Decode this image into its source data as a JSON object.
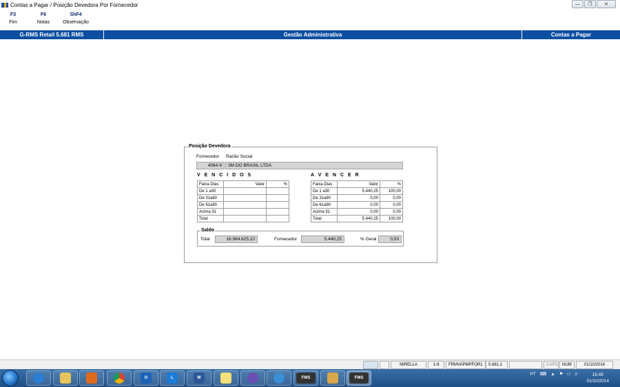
{
  "window": {
    "title": "Contas a Pagar / Posição Devedora Por Fornecedor"
  },
  "fkeys": [
    {
      "key": "F3",
      "label": "Fim"
    },
    {
      "key": "F6",
      "label": "Notas"
    },
    {
      "key": "ShF4",
      "label": "Observação"
    }
  ],
  "header": {
    "system": "G-RMS Retail 5.681 RMS",
    "area": "Gestão Administrativa",
    "module": "Contas a Pagar"
  },
  "panel": {
    "title": "Posição Devedora",
    "fornecedor_label": "Fornecedor",
    "razao_label": "Razão Social",
    "fornecedor_code": "4064-9",
    "razao_social": "3M DO BRASIL LTDA"
  },
  "vencidos": {
    "title": "V E N C I D O S",
    "headers": [
      "Faixa Dias",
      "Valor",
      "%"
    ],
    "rows": [
      {
        "faixa": "De 1 a30",
        "valor": "",
        "pct": ""
      },
      {
        "faixa": "De 31a60",
        "valor": "",
        "pct": ""
      },
      {
        "faixa": "De 61a90",
        "valor": "",
        "pct": ""
      },
      {
        "faixa": "Acima 91",
        "valor": "",
        "pct": ""
      },
      {
        "faixa": "Total",
        "valor": "",
        "pct": ""
      }
    ]
  },
  "avencer": {
    "title": "A V E N C E R",
    "headers": [
      "Faixa Dias",
      "Valor",
      "%"
    ],
    "rows": [
      {
        "faixa": "De 1 a30",
        "valor": "5.440,25",
        "pct": "100,00"
      },
      {
        "faixa": "De 31a60",
        "valor": "0,00",
        "pct": "0,00"
      },
      {
        "faixa": "De 61a90",
        "valor": "0,00",
        "pct": "0,00"
      },
      {
        "faixa": "Acima 91",
        "valor": "0,00",
        "pct": "0,00"
      },
      {
        "faixa": "Total",
        "valor": "5.440,25",
        "pct": "100,00"
      }
    ]
  },
  "saldo": {
    "title": "Saldo",
    "total_label": "Total",
    "total_value": "16.964.625,10",
    "fornecedor_label": "Fornecedor",
    "fornecedor_value": "5.440,25",
    "geral_label": "% Geral",
    "geral_value": "0,03"
  },
  "statusbar": {
    "user": "MIRELLA",
    "range": "1-9",
    "program": "FRMVAPMPFOR1",
    "version": "5.681.1",
    "caps": "CAPS",
    "num": "NUM",
    "date": "01/10/2014"
  },
  "taskbar": {
    "lang": "PT",
    "time": "15:49",
    "date": "01/10/2014",
    "fms_label": "FMS",
    "outlook_label": "O",
    "lync_label": "L",
    "word_label": "W"
  }
}
